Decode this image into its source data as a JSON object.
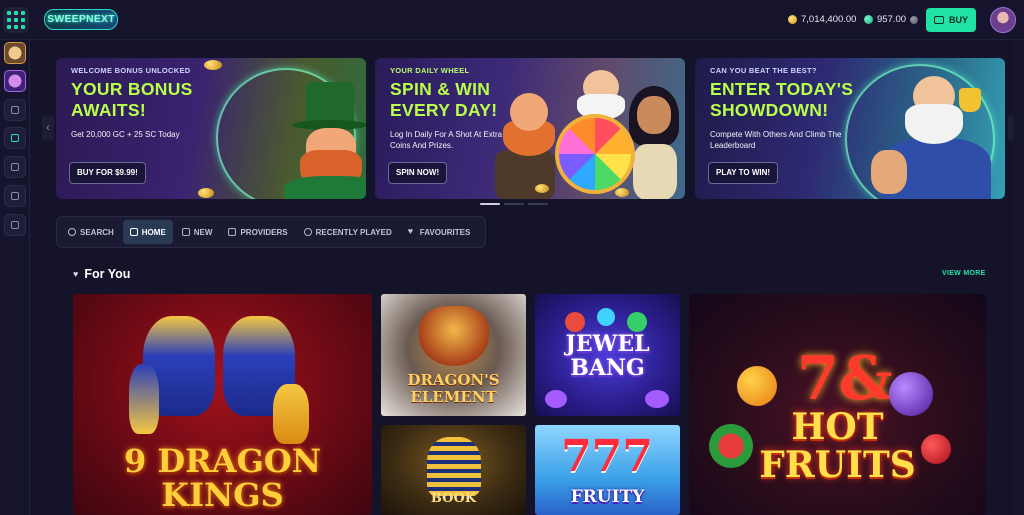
{
  "header": {
    "logo_text": "SWEEPNEXT",
    "gold_balance": "7,014,400.00",
    "sweep_balance": "957.00",
    "buy_label": "BUY"
  },
  "banners": [
    {
      "eyebrow": "WELCOME BONUS UNLOCKED",
      "headline_1": "YOUR BONUS",
      "headline_2": "AWAITS!",
      "subtext": "Get 20,000 GC + 25 SC Today",
      "cta": "BUY FOR $9.99!"
    },
    {
      "eyebrow": "YOUR DAILY WHEEL",
      "headline_1": "SPIN & WIN",
      "headline_2": "EVERY DAY!",
      "subtext": "Log In Daily For A Shot At Extra Coins And Prizes.",
      "cta": "SPIN NOW!"
    },
    {
      "eyebrow": "CAN YOU BEAT THE BEST?",
      "headline_1": "ENTER TODAY'S",
      "headline_2": "SHOWDOWN!",
      "subtext": "Compete With Others And Climb The Leaderboard",
      "cta": "PLAY TO WIN!"
    }
  ],
  "tabs": [
    {
      "label": "SEARCH",
      "active": false
    },
    {
      "label": "HOME",
      "active": true
    },
    {
      "label": "NEW",
      "active": false
    },
    {
      "label": "PROVIDERS",
      "active": false
    },
    {
      "label": "RECENTLY PLAYED",
      "active": false
    },
    {
      "label": "FAVOURITES",
      "active": false
    }
  ],
  "section": {
    "title": "For You",
    "view_more": "VIEW MORE"
  },
  "games": [
    {
      "title_1": "9 DRAGON",
      "title_2": "KINGS"
    },
    {
      "title_1": "DRAGON'S",
      "title_2": "ELEMENT"
    },
    {
      "title_1": "JEWEL",
      "title_2": "BANG"
    },
    {
      "title_1": "HOT",
      "title_2": "FRUITS",
      "prefix": "7&"
    },
    {
      "title_1": "BOOK"
    },
    {
      "title_1": "FRUITY",
      "prefix": "777"
    }
  ],
  "colors": {
    "accent": "#26e2a8",
    "headline": "#b9ff4a",
    "background": "#14132a"
  }
}
